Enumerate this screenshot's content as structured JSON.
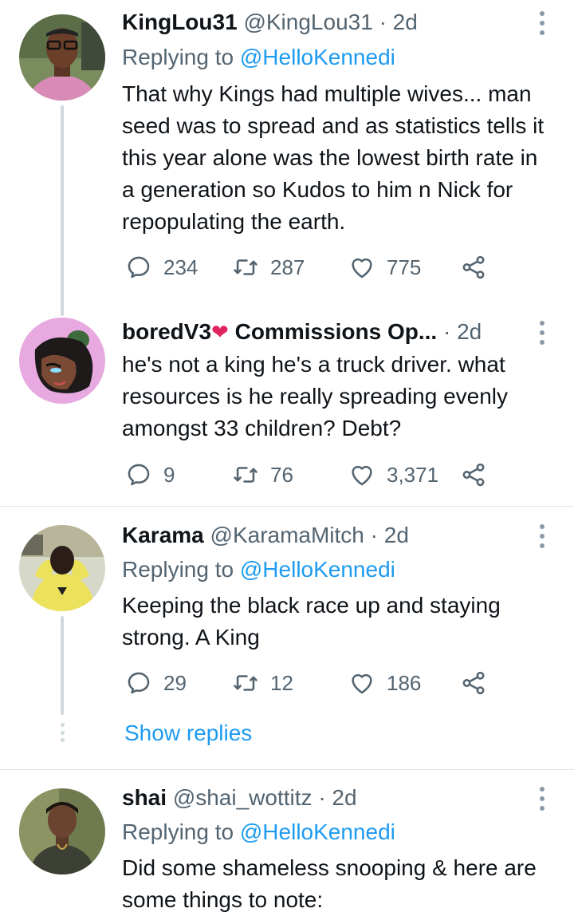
{
  "tweets": [
    {
      "display_name": "KingLou31",
      "handle": "@KingLou31",
      "time": "· 2d",
      "replying_prefix": "Replying to",
      "replying_to": "@HelloKennedi",
      "text": "That why Kings had multiple wives... man seed was to spread and as statistics tells it this year alone was the lowest birth rate in a generation so Kudos to him n Nick for repopulating the earth.",
      "replies": "234",
      "retweets": "287",
      "likes": "775"
    },
    {
      "display_name": "boredV3",
      "emoji": "❤",
      "display_name_2": "Commissions Op...",
      "time": "· 2d",
      "text": "he's not a king he's a truck driver. what resources is he really spreading evenly amongst 33 children? Debt?",
      "replies": "9",
      "retweets": "76",
      "likes": "3,371"
    },
    {
      "display_name": "Karama",
      "handle": "@KaramaMitch",
      "time": "· 2d",
      "replying_prefix": "Replying to",
      "replying_to": "@HelloKennedi",
      "text": "Keeping the black race up and staying strong. A King",
      "replies": "29",
      "retweets": "12",
      "likes": "186",
      "show_replies": "Show replies"
    },
    {
      "display_name": "shai",
      "handle": "@shai_wottitz",
      "time": "· 2d",
      "replying_prefix": "Replying to",
      "replying_to": "@HelloKennedi",
      "text": "Did some shameless snooping & here are some things to note:"
    }
  ],
  "icons": {
    "reply": "reply-icon",
    "retweet": "retweet-icon",
    "like": "heart-icon",
    "share": "share-icon",
    "more": "more-options-icon"
  },
  "colors": {
    "link": "#1d9bf0",
    "secondary": "#536471",
    "text": "#0f1419"
  }
}
